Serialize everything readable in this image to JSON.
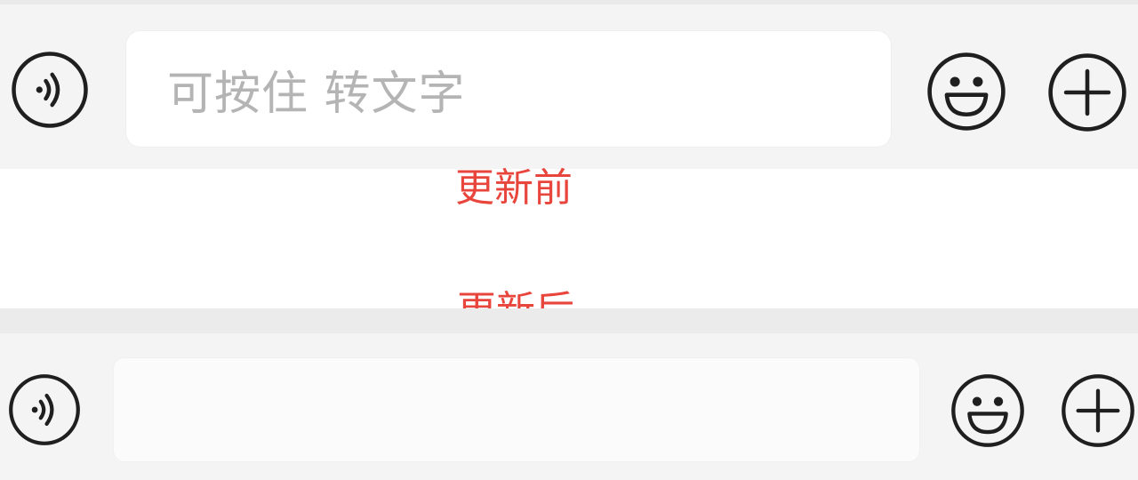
{
  "before": {
    "input": {
      "placeholder": "可按住 转文字"
    },
    "icons": {
      "voice": "voice-icon",
      "emoji": "emoji-icon",
      "plus": "plus-icon"
    }
  },
  "captions": {
    "before": "更新前",
    "after": "更新后"
  },
  "after": {
    "input": {
      "placeholder": ""
    },
    "icons": {
      "voice": "voice-icon",
      "emoji": "emoji-icon",
      "plus": "plus-icon"
    }
  },
  "colors": {
    "caption": "#e8463c",
    "bar_background": "#f4f4f4",
    "placeholder_text": "#b4b4b4",
    "icon_stroke": "#1f1f1f"
  }
}
